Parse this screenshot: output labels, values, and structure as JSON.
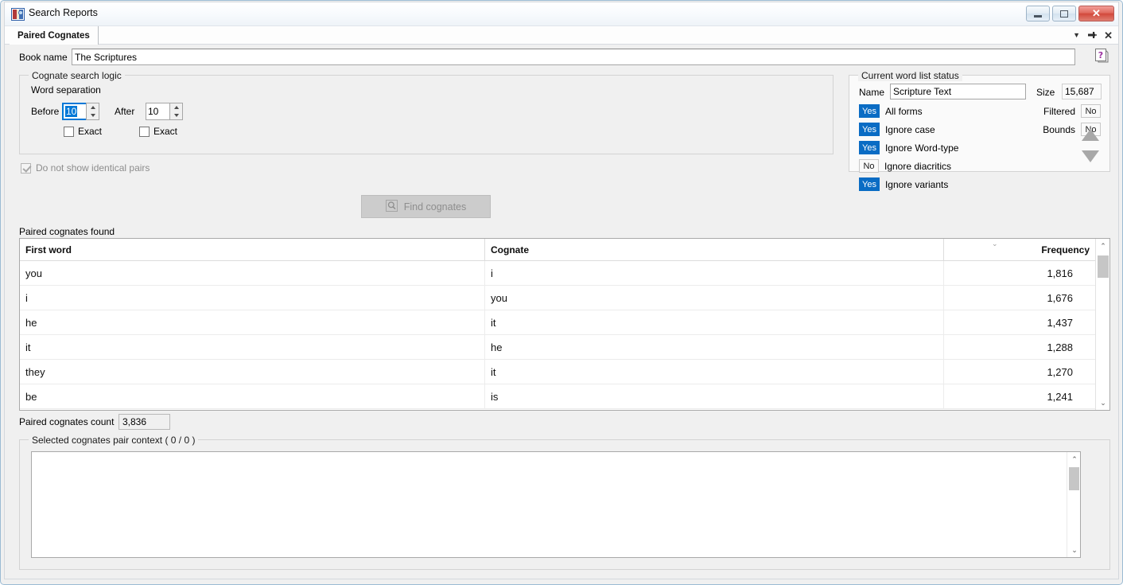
{
  "window": {
    "title": "Search Reports",
    "icon": "book-report-icon",
    "controls": {
      "minimize": "minimize-icon",
      "maximize": "maximize-icon",
      "close": "✕"
    }
  },
  "tabstrip": {
    "tabs": [
      {
        "label": "Paired Cognates",
        "active": true
      }
    ],
    "tools": {
      "dropdown": "▼",
      "pin": "⊣",
      "close": "✕"
    }
  },
  "book": {
    "label": "Book name",
    "value": "The Scriptures",
    "placeholder": "",
    "help_icon": "help-question-icon"
  },
  "cognate_logic": {
    "title": "Cognate search logic",
    "word_separation_label": "Word separation",
    "before": {
      "label": "Before",
      "value": "10",
      "exact_label": "Exact",
      "exact_checked": false,
      "focused": true
    },
    "after": {
      "label": "After",
      "value": "10",
      "exact_label": "Exact",
      "exact_checked": false
    },
    "do_not_show_identical": {
      "label": "Do not show identical pairs",
      "checked": true,
      "disabled": true
    },
    "find_button": {
      "label": "Find cognates",
      "icon": "magnifier-icon",
      "disabled": true
    }
  },
  "wordlist_status": {
    "title": "Current word list status",
    "name_label": "Name",
    "name_value": "Scripture Text",
    "size_label": "Size",
    "size_value": "15,687",
    "flags": [
      {
        "badge": "Yes",
        "state": "yes",
        "label": "All forms"
      },
      {
        "badge": "Yes",
        "state": "yes",
        "label": "Ignore case"
      },
      {
        "badge": "Yes",
        "state": "yes",
        "label": "Ignore Word-type"
      },
      {
        "badge": "No",
        "state": "no",
        "label": "Ignore diacritics"
      },
      {
        "badge": "Yes",
        "state": "yes",
        "label": "Ignore variants"
      }
    ],
    "side_flags": [
      {
        "label": "Filtered",
        "badge": "No",
        "state": "no"
      },
      {
        "label": "Bounds",
        "badge": "No",
        "state": "no"
      }
    ]
  },
  "results": {
    "label": "Paired cognates found",
    "columns": [
      "First word",
      "Cognate",
      "Frequency"
    ],
    "sort_marker": "⌄",
    "sorted_column": "Frequency",
    "sort_direction": "descending",
    "rows": [
      {
        "first_word": "you",
        "cognate": "i",
        "frequency": "1,816"
      },
      {
        "first_word": "i",
        "cognate": "you",
        "frequency": "1,676"
      },
      {
        "first_word": "he",
        "cognate": "it",
        "frequency": "1,437"
      },
      {
        "first_word": "it",
        "cognate": "he",
        "frequency": "1,288"
      },
      {
        "first_word": "they",
        "cognate": "it",
        "frequency": "1,270"
      },
      {
        "first_word": "be",
        "cognate": "is",
        "frequency": "1,241"
      }
    ],
    "scroll_up": "⌃",
    "scroll_down": "⌄"
  },
  "count": {
    "label": "Paired cognates count",
    "value": "3,836"
  },
  "context": {
    "title": "Selected cognates pair context ( 0 / 0 )",
    "text": "",
    "nav_up": "nav-previous-icon",
    "nav_down": "nav-next-icon",
    "scroll_up": "⌃",
    "scroll_down": "⌄"
  },
  "colors": {
    "accent": "#0a6cc4",
    "focus": "#0078d7",
    "close_red": "#d2493c",
    "frame": "#9bbbd4",
    "surface": "#f0f0f0"
  }
}
